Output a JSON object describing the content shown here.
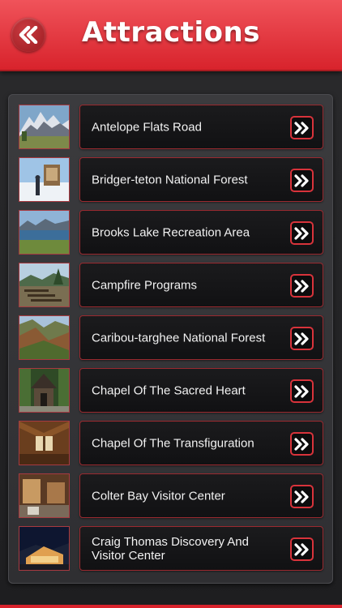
{
  "header": {
    "title": "Attractions",
    "back_icon": "double-chevron-left-icon"
  },
  "colors": {
    "header_red": "#e23c43",
    "accent_border": "#d8333b",
    "background": "#262628"
  },
  "attractions": [
    {
      "label": "Antelope Flats Road"
    },
    {
      "label": "Bridger-teton National Forest"
    },
    {
      "label": "Brooks Lake Recreation Area"
    },
    {
      "label": "Campfire Programs"
    },
    {
      "label": "Caribou-targhee National Forest"
    },
    {
      "label": "Chapel Of The Sacred Heart"
    },
    {
      "label": "Chapel Of The Transfiguration"
    },
    {
      "label": "Colter Bay Visitor Center"
    },
    {
      "label": "Craig Thomas Discovery And Visitor Center"
    }
  ],
  "row_icon": "double-chevron-right-icon"
}
